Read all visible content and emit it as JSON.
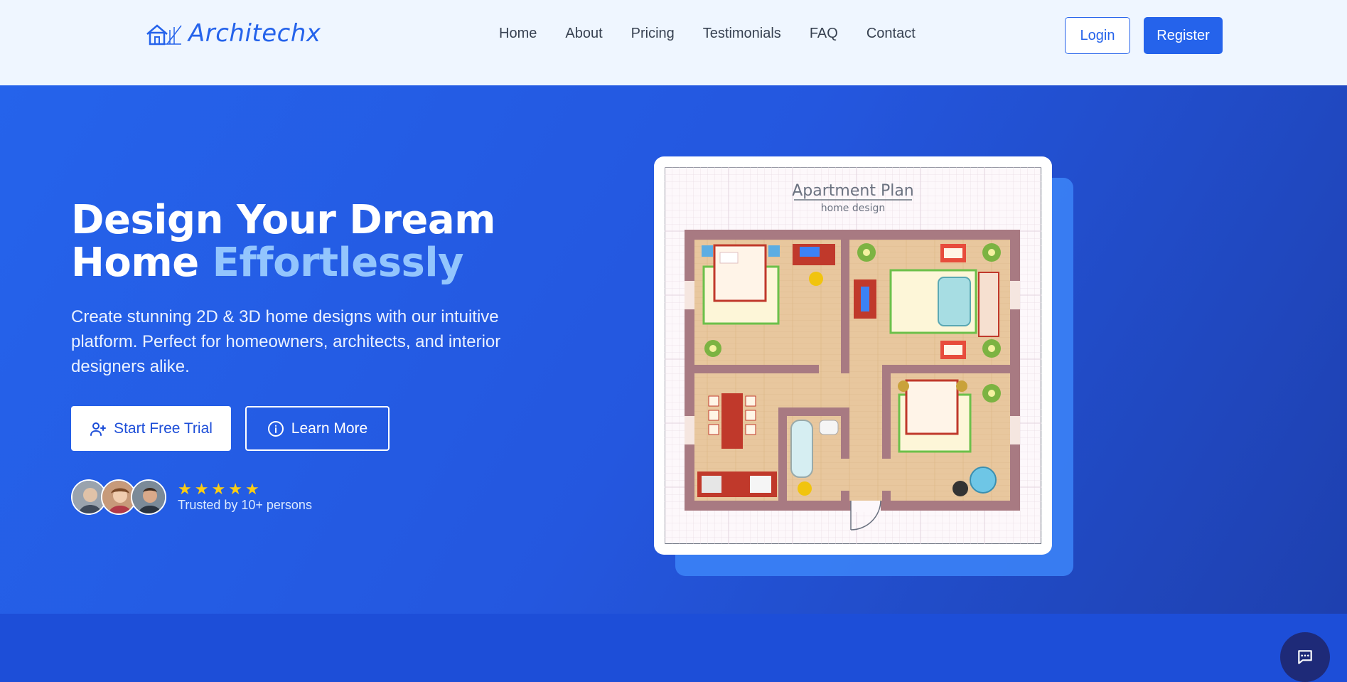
{
  "brand": {
    "name": "Architechx",
    "color": "#2563eb"
  },
  "nav": {
    "items": [
      "Home",
      "About",
      "Pricing",
      "Testimonials",
      "FAQ",
      "Contact"
    ],
    "login": "Login",
    "register": "Register"
  },
  "hero": {
    "headline_line1": "Design Your Dream",
    "headline_line2_prefix": "Home ",
    "headline_accent": "Effortlessly",
    "subtext": "Create stunning 2D & 3D home designs with our intuitive platform. Perfect for homeowners, architects, and interior designers alike.",
    "cta_primary": "Start Free Trial",
    "cta_secondary": "Learn More",
    "rating_stars": 5,
    "trusted_text": "Trusted by 10+ persons"
  },
  "plan": {
    "title": "Apartment Plan",
    "subtitle": "home design"
  },
  "colors": {
    "accent": "#93c5fd",
    "primary": "#2563eb",
    "star": "#facc15",
    "chat": "#1e2a78"
  },
  "icons": {
    "trial": "user-plus-icon",
    "learn": "info-icon",
    "chat": "chat-icon"
  }
}
